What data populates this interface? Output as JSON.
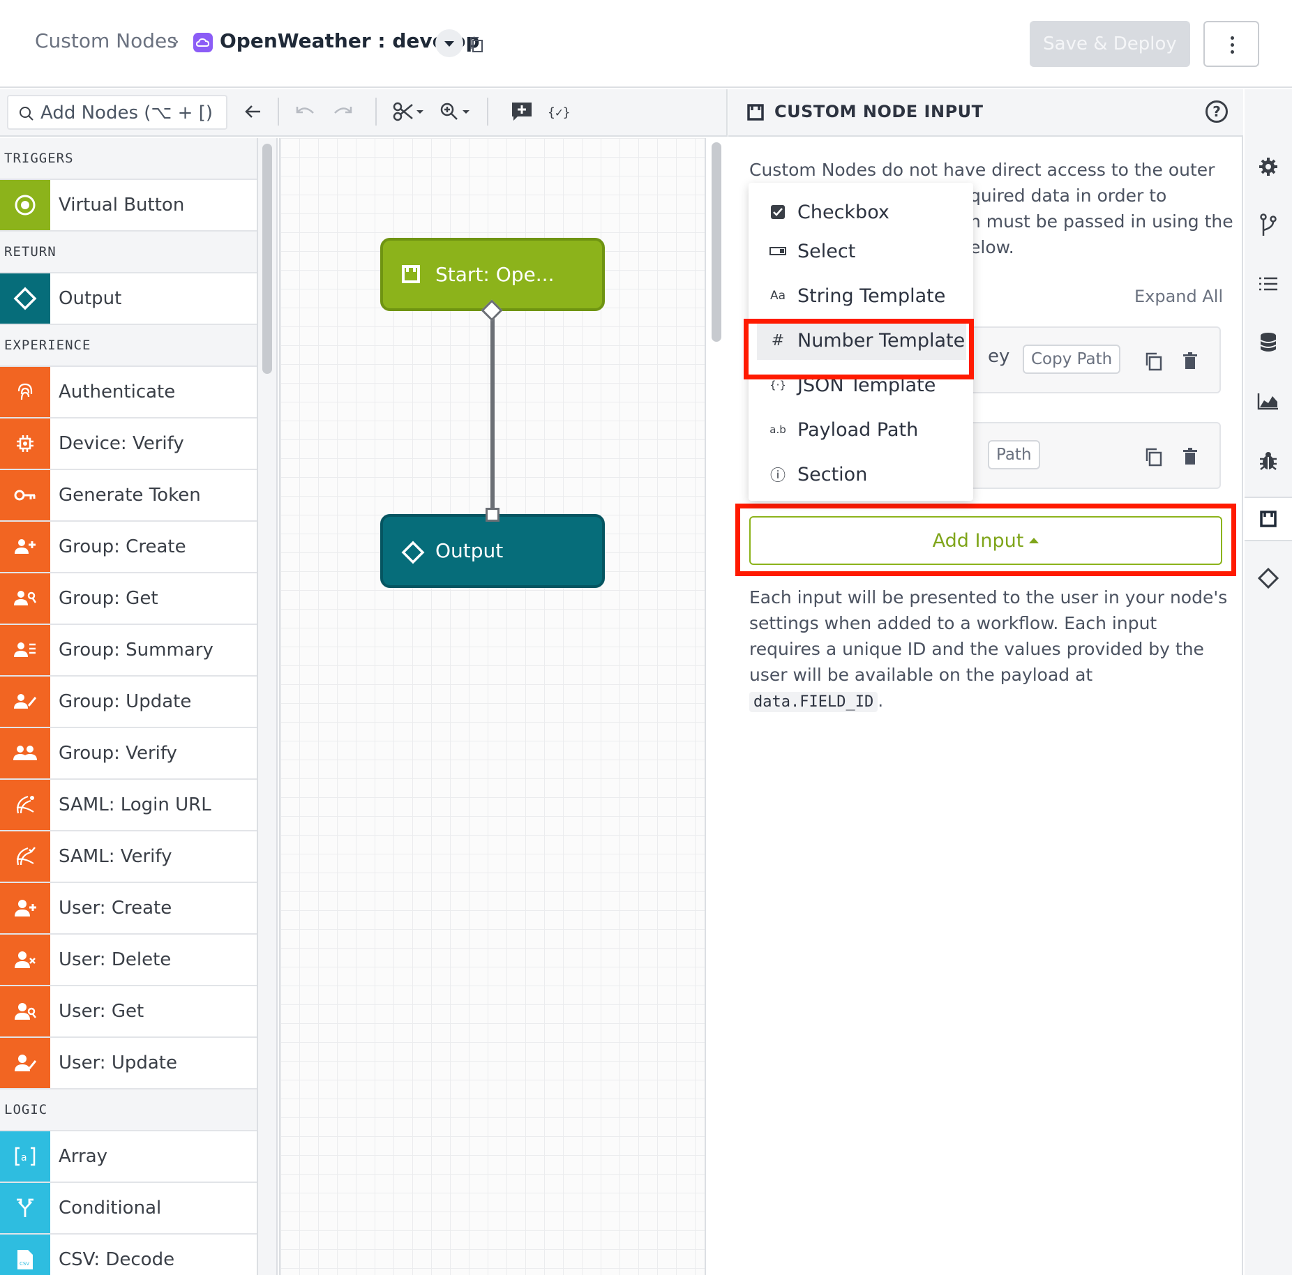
{
  "header": {
    "breadcrumb_root": "Custom Nodes",
    "breadcrumb_sep": "›",
    "app_name": "OpenWeather : develop",
    "save_label": "Save & Deploy"
  },
  "toolbar": {
    "search_placeholder": "Add Nodes (⌥ + [)"
  },
  "palette": {
    "sections": [
      {
        "title": "TRIGGERS",
        "items": [
          {
            "label": "Virtual Button",
            "icon": "target-icon",
            "color": "#8cb31b"
          }
        ]
      },
      {
        "title": "RETURN",
        "items": [
          {
            "label": "Output",
            "icon": "diamond-icon",
            "color": "#066d7a"
          }
        ]
      },
      {
        "title": "EXPERIENCE",
        "items": [
          {
            "label": "Authenticate",
            "icon": "fingerprint-icon",
            "color": "#f26522"
          },
          {
            "label": "Device: Verify",
            "icon": "chip-icon",
            "color": "#f26522"
          },
          {
            "label": "Generate Token",
            "icon": "key-icon",
            "color": "#f26522"
          },
          {
            "label": "Group: Create",
            "icon": "group-add-icon",
            "color": "#f26522"
          },
          {
            "label": "Group: Get",
            "icon": "group-search-icon",
            "color": "#f26522"
          },
          {
            "label": "Group: Summary",
            "icon": "group-list-icon",
            "color": "#f26522"
          },
          {
            "label": "Group: Update",
            "icon": "group-edit-icon",
            "color": "#f26522"
          },
          {
            "label": "Group: Verify",
            "icon": "group-icon",
            "color": "#f26522"
          },
          {
            "label": "SAML: Login URL",
            "icon": "saml-icon",
            "color": "#f26522"
          },
          {
            "label": "SAML: Verify",
            "icon": "saml-verify-icon",
            "color": "#f26522"
          },
          {
            "label": "User: Create",
            "icon": "user-add-icon",
            "color": "#f26522"
          },
          {
            "label": "User: Delete",
            "icon": "user-remove-icon",
            "color": "#f26522"
          },
          {
            "label": "User: Get",
            "icon": "user-search-icon",
            "color": "#f26522"
          },
          {
            "label": "User: Update",
            "icon": "user-edit-icon",
            "color": "#f26522"
          }
        ]
      },
      {
        "title": "LOGIC",
        "items": [
          {
            "label": "Array",
            "icon": "array-icon",
            "color": "#2ebde0"
          },
          {
            "label": "Conditional",
            "icon": "branch-icon",
            "color": "#2ebde0"
          },
          {
            "label": "CSV: Decode",
            "icon": "csv-file-icon",
            "color": "#2ebde0"
          }
        ]
      }
    ]
  },
  "canvas": {
    "start_node": "Start: Ope...",
    "output_node": "Output"
  },
  "panel": {
    "title": "CUSTOM NODE INPUT",
    "help": "?",
    "intro_line1": "Custom Nodes do not have direct access to the outer",
    "intro_line2": "quired data in order to",
    "intro_line3": "n must be passed in using the",
    "intro_line4": "elow.",
    "expand_all": "Expand All",
    "card1_tail": "ey",
    "card1_copy": "Copy Path",
    "card2_copy": "Path",
    "add_input": "Add Input",
    "footer_text": "Each input will be presented to the user in your node's settings when added to a workflow. Each input requires a unique ID and the values provided by the user will be available on the payload at",
    "footer_code": "data.FIELD_ID",
    "footer_end": "."
  },
  "menu": {
    "items": [
      {
        "label": "Checkbox",
        "icon": "checkbox-icon"
      },
      {
        "label": "Select",
        "icon": "select-icon"
      },
      {
        "label": "String Template",
        "icon": "text-icon",
        "glyph": "Aa"
      },
      {
        "label": "Number Template",
        "icon": "hash-icon",
        "glyph": "#"
      },
      {
        "label": "JSON Template",
        "icon": "json-icon",
        "glyph": "{·}"
      },
      {
        "label": "Payload Path",
        "icon": "path-icon",
        "glyph": "a.b"
      },
      {
        "label": "Section",
        "icon": "info-icon",
        "glyph": "ⓘ"
      }
    ],
    "highlighted": "Number Template"
  },
  "colors": {
    "trigger": "#8cb31b",
    "return": "#066d7a",
    "experience": "#f26522",
    "logic": "#2ebde0",
    "highlight": "#ff1a00",
    "app_icon": "#8b5cf6"
  }
}
